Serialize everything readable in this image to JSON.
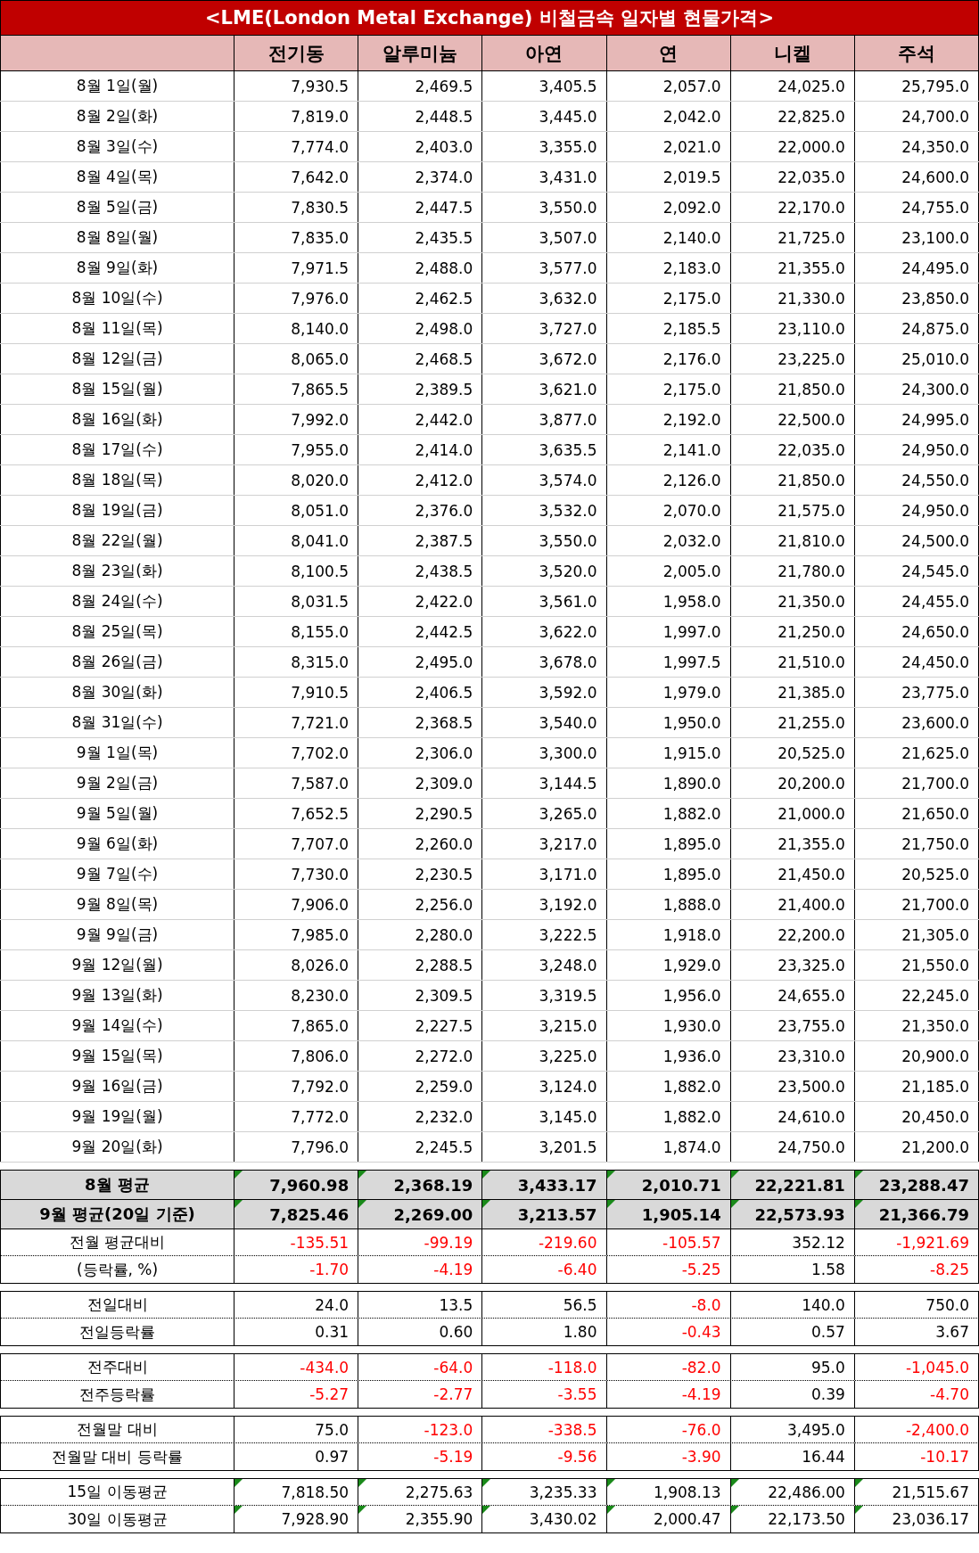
{
  "title": "<LME(London Metal Exchange) 비철금속 일자별 현물가격>",
  "columns": [
    "전기동",
    "알루미늄",
    "아연",
    "연",
    "니켈",
    "주석"
  ],
  "rows": [
    {
      "date": "8월 1일(월)",
      "values": [
        "7,930.5",
        "2,469.5",
        "3,405.5",
        "2,057.0",
        "24,025.0",
        "25,795.0"
      ]
    },
    {
      "date": "8월 2일(화)",
      "values": [
        "7,819.0",
        "2,448.5",
        "3,445.0",
        "2,042.0",
        "22,825.0",
        "24,700.0"
      ]
    },
    {
      "date": "8월 3일(수)",
      "values": [
        "7,774.0",
        "2,403.0",
        "3,355.0",
        "2,021.0",
        "22,000.0",
        "24,350.0"
      ]
    },
    {
      "date": "8월 4일(목)",
      "values": [
        "7,642.0",
        "2,374.0",
        "3,431.0",
        "2,019.5",
        "22,035.0",
        "24,600.0"
      ]
    },
    {
      "date": "8월 5일(금)",
      "values": [
        "7,830.5",
        "2,447.5",
        "3,550.0",
        "2,092.0",
        "22,170.0",
        "24,755.0"
      ]
    },
    {
      "date": "8월 8일(월)",
      "values": [
        "7,835.0",
        "2,435.5",
        "3,507.0",
        "2,140.0",
        "21,725.0",
        "23,100.0"
      ]
    },
    {
      "date": "8월 9일(화)",
      "values": [
        "7,971.5",
        "2,488.0",
        "3,577.0",
        "2,183.0",
        "21,355.0",
        "24,495.0"
      ]
    },
    {
      "date": "8월 10일(수)",
      "values": [
        "7,976.0",
        "2,462.5",
        "3,632.0",
        "2,175.0",
        "21,330.0",
        "23,850.0"
      ]
    },
    {
      "date": "8월 11일(목)",
      "values": [
        "8,140.0",
        "2,498.0",
        "3,727.0",
        "2,185.5",
        "23,110.0",
        "24,875.0"
      ]
    },
    {
      "date": "8월 12일(금)",
      "values": [
        "8,065.0",
        "2,468.5",
        "3,672.0",
        "2,176.0",
        "23,225.0",
        "25,010.0"
      ]
    },
    {
      "date": "8월 15일(월)",
      "values": [
        "7,865.5",
        "2,389.5",
        "3,621.0",
        "2,175.0",
        "21,850.0",
        "24,300.0"
      ]
    },
    {
      "date": "8월 16일(화)",
      "values": [
        "7,992.0",
        "2,442.0",
        "3,877.0",
        "2,192.0",
        "22,500.0",
        "24,995.0"
      ]
    },
    {
      "date": "8월 17일(수)",
      "values": [
        "7,955.0",
        "2,414.0",
        "3,635.5",
        "2,141.0",
        "22,035.0",
        "24,950.0"
      ]
    },
    {
      "date": "8월 18일(목)",
      "values": [
        "8,020.0",
        "2,412.0",
        "3,574.0",
        "2,126.0",
        "21,850.0",
        "24,550.0"
      ]
    },
    {
      "date": "8월 19일(금)",
      "values": [
        "8,051.0",
        "2,376.0",
        "3,532.0",
        "2,070.0",
        "21,575.0",
        "24,950.0"
      ]
    },
    {
      "date": "8월 22일(월)",
      "values": [
        "8,041.0",
        "2,387.5",
        "3,550.0",
        "2,032.0",
        "21,810.0",
        "24,500.0"
      ]
    },
    {
      "date": "8월 23일(화)",
      "values": [
        "8,100.5",
        "2,438.5",
        "3,520.0",
        "2,005.0",
        "21,780.0",
        "24,545.0"
      ]
    },
    {
      "date": "8월 24일(수)",
      "values": [
        "8,031.5",
        "2,422.0",
        "3,561.0",
        "1,958.0",
        "21,350.0",
        "24,455.0"
      ]
    },
    {
      "date": "8월 25일(목)",
      "values": [
        "8,155.0",
        "2,442.5",
        "3,622.0",
        "1,997.0",
        "21,250.0",
        "24,650.0"
      ]
    },
    {
      "date": "8월 26일(금)",
      "values": [
        "8,315.0",
        "2,495.0",
        "3,678.0",
        "1,997.5",
        "21,510.0",
        "24,450.0"
      ]
    },
    {
      "date": "8월 30일(화)",
      "values": [
        "7,910.5",
        "2,406.5",
        "3,592.0",
        "1,979.0",
        "21,385.0",
        "23,775.0"
      ]
    },
    {
      "date": "8월 31일(수)",
      "values": [
        "7,721.0",
        "2,368.5",
        "3,540.0",
        "1,950.0",
        "21,255.0",
        "23,600.0"
      ]
    },
    {
      "date": "9월 1일(목)",
      "values": [
        "7,702.0",
        "2,306.0",
        "3,300.0",
        "1,915.0",
        "20,525.0",
        "21,625.0"
      ]
    },
    {
      "date": "9월 2일(금)",
      "values": [
        "7,587.0",
        "2,309.0",
        "3,144.5",
        "1,890.0",
        "20,200.0",
        "21,700.0"
      ]
    },
    {
      "date": "9월 5일(월)",
      "values": [
        "7,652.5",
        "2,290.5",
        "3,265.0",
        "1,882.0",
        "21,000.0",
        "21,650.0"
      ]
    },
    {
      "date": "9월 6일(화)",
      "values": [
        "7,707.0",
        "2,260.0",
        "3,217.0",
        "1,895.0",
        "21,355.0",
        "21,750.0"
      ]
    },
    {
      "date": "9월 7일(수)",
      "values": [
        "7,730.0",
        "2,230.5",
        "3,171.0",
        "1,895.0",
        "21,450.0",
        "20,525.0"
      ]
    },
    {
      "date": "9월 8일(목)",
      "values": [
        "7,906.0",
        "2,256.0",
        "3,192.0",
        "1,888.0",
        "21,400.0",
        "21,700.0"
      ]
    },
    {
      "date": "9월 9일(금)",
      "values": [
        "7,985.0",
        "2,280.0",
        "3,222.5",
        "1,918.0",
        "22,200.0",
        "21,305.0"
      ]
    },
    {
      "date": "9월 12일(월)",
      "values": [
        "8,026.0",
        "2,288.5",
        "3,248.0",
        "1,929.0",
        "23,325.0",
        "21,550.0"
      ]
    },
    {
      "date": "9월 13일(화)",
      "values": [
        "8,230.0",
        "2,309.5",
        "3,319.5",
        "1,956.0",
        "24,655.0",
        "22,245.0"
      ]
    },
    {
      "date": "9월 14일(수)",
      "values": [
        "7,865.0",
        "2,227.5",
        "3,215.0",
        "1,930.0",
        "23,755.0",
        "21,350.0"
      ]
    },
    {
      "date": "9월 15일(목)",
      "values": [
        "7,806.0",
        "2,272.0",
        "3,225.0",
        "1,936.0",
        "23,310.0",
        "20,900.0"
      ]
    },
    {
      "date": "9월 16일(금)",
      "values": [
        "7,792.0",
        "2,259.0",
        "3,124.0",
        "1,882.0",
        "23,500.0",
        "21,185.0"
      ]
    },
    {
      "date": "9월 19일(월)",
      "values": [
        "7,772.0",
        "2,232.0",
        "3,145.0",
        "1,882.0",
        "24,610.0",
        "20,450.0"
      ]
    },
    {
      "date": "9월 20일(화)",
      "values": [
        "7,796.0",
        "2,245.5",
        "3,201.5",
        "1,874.0",
        "24,750.0",
        "21,200.0"
      ]
    }
  ],
  "summary_groups": [
    {
      "rows": [
        {
          "kind": "average",
          "label": "8월 평균",
          "flagged": true,
          "cells": [
            {
              "text": "7,960.98",
              "red": false
            },
            {
              "text": "2,368.19",
              "red": false
            },
            {
              "text": "3,433.17",
              "red": false
            },
            {
              "text": "2,010.71",
              "red": false
            },
            {
              "text": "22,221.81",
              "red": false
            },
            {
              "text": "23,288.47",
              "red": false
            }
          ]
        },
        {
          "kind": "average",
          "label": "9월 평균(20일 기준)",
          "flagged": true,
          "cells": [
            {
              "text": "7,825.46",
              "red": false
            },
            {
              "text": "2,269.00",
              "red": false
            },
            {
              "text": "3,213.57",
              "red": false
            },
            {
              "text": "1,905.14",
              "red": false
            },
            {
              "text": "22,573.93",
              "red": false
            },
            {
              "text": "21,366.79",
              "red": false
            }
          ]
        },
        {
          "kind": "plain",
          "label": "전월 평균대비",
          "flagged": false,
          "cells": [
            {
              "text": "-135.51",
              "red": true
            },
            {
              "text": "-99.19",
              "red": true
            },
            {
              "text": "-219.60",
              "red": true
            },
            {
              "text": "-105.57",
              "red": true
            },
            {
              "text": "352.12",
              "red": false
            },
            {
              "text": "-1,921.69",
              "red": true
            }
          ]
        },
        {
          "kind": "plain",
          "label": "(등락률, %)",
          "flagged": false,
          "cells": [
            {
              "text": "-1.70",
              "red": true
            },
            {
              "text": "-4.19",
              "red": true
            },
            {
              "text": "-6.40",
              "red": true
            },
            {
              "text": "-5.25",
              "red": true
            },
            {
              "text": "1.58",
              "red": false
            },
            {
              "text": "-8.25",
              "red": true
            }
          ]
        }
      ]
    },
    {
      "rows": [
        {
          "kind": "plain",
          "label": "전일대비",
          "flagged": false,
          "cells": [
            {
              "text": "24.0",
              "red": false
            },
            {
              "text": "13.5",
              "red": false
            },
            {
              "text": "56.5",
              "red": false
            },
            {
              "text": "-8.0",
              "red": true
            },
            {
              "text": "140.0",
              "red": false
            },
            {
              "text": "750.0",
              "red": false
            }
          ]
        },
        {
          "kind": "plain",
          "label": "전일등락률",
          "flagged": false,
          "cells": [
            {
              "text": "0.31",
              "red": false
            },
            {
              "text": "0.60",
              "red": false
            },
            {
              "text": "1.80",
              "red": false
            },
            {
              "text": "-0.43",
              "red": true
            },
            {
              "text": "0.57",
              "red": false
            },
            {
              "text": "3.67",
              "red": false
            }
          ]
        }
      ]
    },
    {
      "rows": [
        {
          "kind": "plain",
          "label": "전주대비",
          "flagged": false,
          "cells": [
            {
              "text": "-434.0",
              "red": true
            },
            {
              "text": "-64.0",
              "red": true
            },
            {
              "text": "-118.0",
              "red": true
            },
            {
              "text": "-82.0",
              "red": true
            },
            {
              "text": "95.0",
              "red": false
            },
            {
              "text": "-1,045.0",
              "red": true
            }
          ]
        },
        {
          "kind": "plain",
          "label": "전주등락률",
          "flagged": false,
          "cells": [
            {
              "text": "-5.27",
              "red": true
            },
            {
              "text": "-2.77",
              "red": true
            },
            {
              "text": "-3.55",
              "red": true
            },
            {
              "text": "-4.19",
              "red": true
            },
            {
              "text": "0.39",
              "red": false
            },
            {
              "text": "-4.70",
              "red": true
            }
          ]
        }
      ]
    },
    {
      "rows": [
        {
          "kind": "plain",
          "label": "전월말 대비",
          "flagged": false,
          "cells": [
            {
              "text": "75.0",
              "red": false
            },
            {
              "text": "-123.0",
              "red": true
            },
            {
              "text": "-338.5",
              "red": true
            },
            {
              "text": "-76.0",
              "red": true
            },
            {
              "text": "3,495.0",
              "red": false
            },
            {
              "text": "-2,400.0",
              "red": true
            }
          ]
        },
        {
          "kind": "plain",
          "label": "전월말 대비 등락률",
          "flagged": false,
          "cells": [
            {
              "text": "0.97",
              "red": false
            },
            {
              "text": "-5.19",
              "red": true
            },
            {
              "text": "-9.56",
              "red": true
            },
            {
              "text": "-3.90",
              "red": true
            },
            {
              "text": "16.44",
              "red": false
            },
            {
              "text": "-10.17",
              "red": true
            }
          ]
        }
      ]
    },
    {
      "rows": [
        {
          "kind": "plain",
          "label": "15일 이동평균",
          "flagged": true,
          "cells": [
            {
              "text": "7,818.50",
              "red": false
            },
            {
              "text": "2,275.63",
              "red": false
            },
            {
              "text": "3,235.33",
              "red": false
            },
            {
              "text": "1,908.13",
              "red": false
            },
            {
              "text": "22,486.00",
              "red": false
            },
            {
              "text": "21,515.67",
              "red": false
            }
          ]
        },
        {
          "kind": "plain",
          "label": "30일 이동평균",
          "flagged": true,
          "cells": [
            {
              "text": "7,928.90",
              "red": false
            },
            {
              "text": "2,355.90",
              "red": false
            },
            {
              "text": "3,430.02",
              "red": false
            },
            {
              "text": "2,000.47",
              "red": false
            },
            {
              "text": "22,173.50",
              "red": false
            },
            {
              "text": "23,036.17",
              "red": false
            }
          ]
        }
      ]
    }
  ]
}
